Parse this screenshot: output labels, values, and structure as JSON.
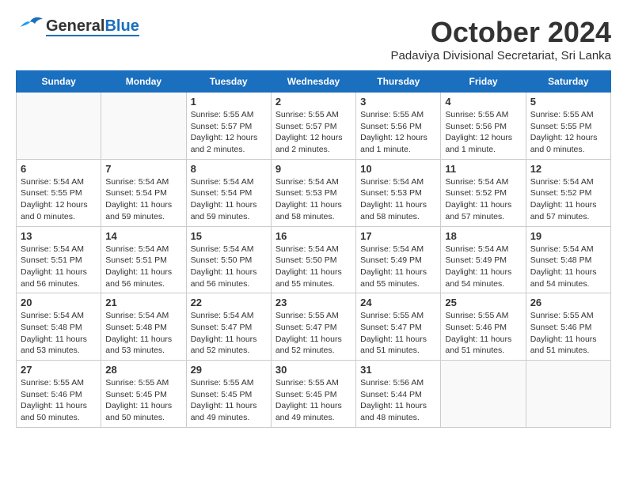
{
  "logo": {
    "general": "General",
    "blue": "Blue"
  },
  "title": "October 2024",
  "subtitle": "Padaviya Divisional Secretariat, Sri Lanka",
  "days_of_week": [
    "Sunday",
    "Monday",
    "Tuesday",
    "Wednesday",
    "Thursday",
    "Friday",
    "Saturday"
  ],
  "weeks": [
    [
      {
        "day": "",
        "info": ""
      },
      {
        "day": "",
        "info": ""
      },
      {
        "day": "1",
        "info": "Sunrise: 5:55 AM\nSunset: 5:57 PM\nDaylight: 12 hours and 2 minutes."
      },
      {
        "day": "2",
        "info": "Sunrise: 5:55 AM\nSunset: 5:57 PM\nDaylight: 12 hours and 2 minutes."
      },
      {
        "day": "3",
        "info": "Sunrise: 5:55 AM\nSunset: 5:56 PM\nDaylight: 12 hours and 1 minute."
      },
      {
        "day": "4",
        "info": "Sunrise: 5:55 AM\nSunset: 5:56 PM\nDaylight: 12 hours and 1 minute."
      },
      {
        "day": "5",
        "info": "Sunrise: 5:55 AM\nSunset: 5:55 PM\nDaylight: 12 hours and 0 minutes."
      }
    ],
    [
      {
        "day": "6",
        "info": "Sunrise: 5:54 AM\nSunset: 5:55 PM\nDaylight: 12 hours and 0 minutes."
      },
      {
        "day": "7",
        "info": "Sunrise: 5:54 AM\nSunset: 5:54 PM\nDaylight: 11 hours and 59 minutes."
      },
      {
        "day": "8",
        "info": "Sunrise: 5:54 AM\nSunset: 5:54 PM\nDaylight: 11 hours and 59 minutes."
      },
      {
        "day": "9",
        "info": "Sunrise: 5:54 AM\nSunset: 5:53 PM\nDaylight: 11 hours and 58 minutes."
      },
      {
        "day": "10",
        "info": "Sunrise: 5:54 AM\nSunset: 5:53 PM\nDaylight: 11 hours and 58 minutes."
      },
      {
        "day": "11",
        "info": "Sunrise: 5:54 AM\nSunset: 5:52 PM\nDaylight: 11 hours and 57 minutes."
      },
      {
        "day": "12",
        "info": "Sunrise: 5:54 AM\nSunset: 5:52 PM\nDaylight: 11 hours and 57 minutes."
      }
    ],
    [
      {
        "day": "13",
        "info": "Sunrise: 5:54 AM\nSunset: 5:51 PM\nDaylight: 11 hours and 56 minutes."
      },
      {
        "day": "14",
        "info": "Sunrise: 5:54 AM\nSunset: 5:51 PM\nDaylight: 11 hours and 56 minutes."
      },
      {
        "day": "15",
        "info": "Sunrise: 5:54 AM\nSunset: 5:50 PM\nDaylight: 11 hours and 56 minutes."
      },
      {
        "day": "16",
        "info": "Sunrise: 5:54 AM\nSunset: 5:50 PM\nDaylight: 11 hours and 55 minutes."
      },
      {
        "day": "17",
        "info": "Sunrise: 5:54 AM\nSunset: 5:49 PM\nDaylight: 11 hours and 55 minutes."
      },
      {
        "day": "18",
        "info": "Sunrise: 5:54 AM\nSunset: 5:49 PM\nDaylight: 11 hours and 54 minutes."
      },
      {
        "day": "19",
        "info": "Sunrise: 5:54 AM\nSunset: 5:48 PM\nDaylight: 11 hours and 54 minutes."
      }
    ],
    [
      {
        "day": "20",
        "info": "Sunrise: 5:54 AM\nSunset: 5:48 PM\nDaylight: 11 hours and 53 minutes."
      },
      {
        "day": "21",
        "info": "Sunrise: 5:54 AM\nSunset: 5:48 PM\nDaylight: 11 hours and 53 minutes."
      },
      {
        "day": "22",
        "info": "Sunrise: 5:54 AM\nSunset: 5:47 PM\nDaylight: 11 hours and 52 minutes."
      },
      {
        "day": "23",
        "info": "Sunrise: 5:55 AM\nSunset: 5:47 PM\nDaylight: 11 hours and 52 minutes."
      },
      {
        "day": "24",
        "info": "Sunrise: 5:55 AM\nSunset: 5:47 PM\nDaylight: 11 hours and 51 minutes."
      },
      {
        "day": "25",
        "info": "Sunrise: 5:55 AM\nSunset: 5:46 PM\nDaylight: 11 hours and 51 minutes."
      },
      {
        "day": "26",
        "info": "Sunrise: 5:55 AM\nSunset: 5:46 PM\nDaylight: 11 hours and 51 minutes."
      }
    ],
    [
      {
        "day": "27",
        "info": "Sunrise: 5:55 AM\nSunset: 5:46 PM\nDaylight: 11 hours and 50 minutes."
      },
      {
        "day": "28",
        "info": "Sunrise: 5:55 AM\nSunset: 5:45 PM\nDaylight: 11 hours and 50 minutes."
      },
      {
        "day": "29",
        "info": "Sunrise: 5:55 AM\nSunset: 5:45 PM\nDaylight: 11 hours and 49 minutes."
      },
      {
        "day": "30",
        "info": "Sunrise: 5:55 AM\nSunset: 5:45 PM\nDaylight: 11 hours and 49 minutes."
      },
      {
        "day": "31",
        "info": "Sunrise: 5:56 AM\nSunset: 5:44 PM\nDaylight: 11 hours and 48 minutes."
      },
      {
        "day": "",
        "info": ""
      },
      {
        "day": "",
        "info": ""
      }
    ]
  ]
}
